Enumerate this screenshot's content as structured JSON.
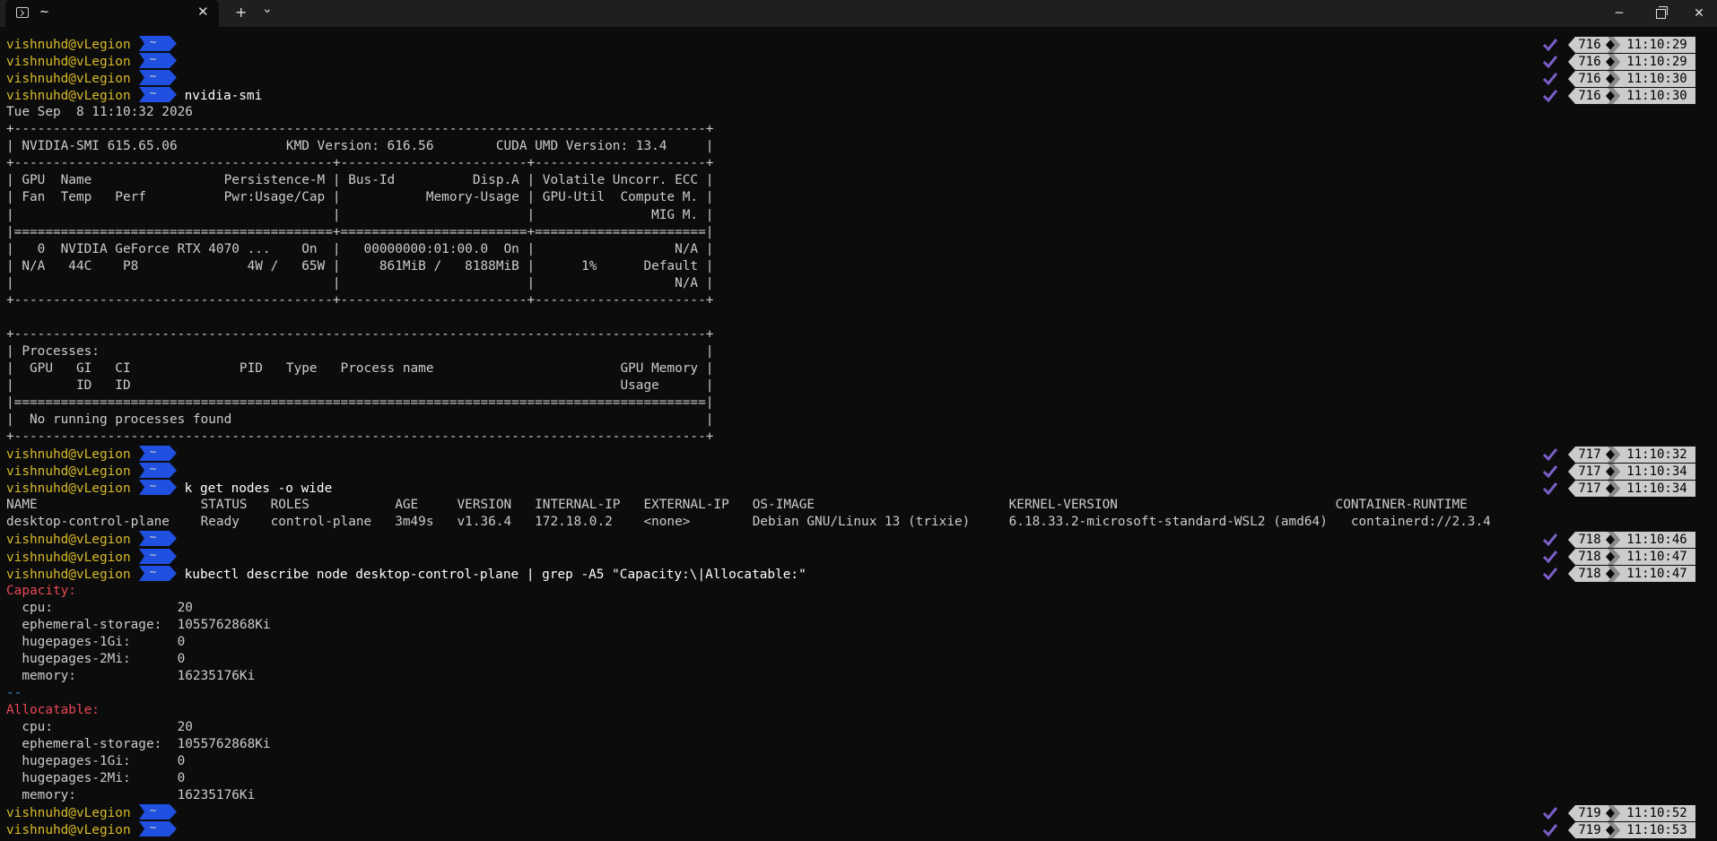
{
  "window": {
    "tab_title": "~",
    "tab_icon": "terminal-icon",
    "new_tab_label": "+",
    "dropdown_label": "⌄",
    "close_tab_label": "✕",
    "minimize_label": "─",
    "close_label": "✕"
  },
  "prompt": {
    "user": "vishnuhd@vLegion",
    "dir": "~",
    "colors": {
      "user": "#d7ba2a",
      "arrow": "#1f50e0",
      "status_bg": "#cccccc",
      "check": "#7a5fc8"
    }
  },
  "lines": [
    {
      "type": "prompt",
      "cmd": "",
      "num": "716",
      "time": "11:10:29"
    },
    {
      "type": "prompt",
      "cmd": "",
      "num": "716",
      "time": "11:10:29"
    },
    {
      "type": "prompt",
      "cmd": "",
      "num": "716",
      "time": "11:10:30"
    },
    {
      "type": "prompt",
      "cmd": "nvidia-smi",
      "num": "716",
      "time": "11:10:30"
    },
    {
      "type": "text",
      "text": "Tue Sep  8 11:10:32 2026"
    },
    {
      "type": "text",
      "text": "+-----------------------------------------------------------------------------------------+"
    },
    {
      "type": "text",
      "text": "| NVIDIA-SMI 615.65.06              KMD Version: 616.56        CUDA UMD Version: 13.4     |"
    },
    {
      "type": "text",
      "text": "+-----------------------------------------+------------------------+----------------------+"
    },
    {
      "type": "text",
      "text": "| GPU  Name                 Persistence-M | Bus-Id          Disp.A | Volatile Uncorr. ECC |"
    },
    {
      "type": "text",
      "text": "| Fan  Temp   Perf          Pwr:Usage/Cap |           Memory-Usage | GPU-Util  Compute M. |"
    },
    {
      "type": "text",
      "text": "|                                         |                        |               MIG M. |"
    },
    {
      "type": "text",
      "text": "|=========================================+========================+======================|"
    },
    {
      "type": "text",
      "text": "|   0  NVIDIA GeForce RTX 4070 ...    On  |   00000000:01:00.0  On |                  N/A |"
    },
    {
      "type": "text",
      "text": "| N/A   44C    P8              4W /   65W |     861MiB /   8188MiB |      1%      Default |"
    },
    {
      "type": "text",
      "text": "|                                         |                        |                  N/A |"
    },
    {
      "type": "text",
      "text": "+-----------------------------------------+------------------------+----------------------+"
    },
    {
      "type": "text",
      "text": ""
    },
    {
      "type": "text",
      "text": "+-----------------------------------------------------------------------------------------+"
    },
    {
      "type": "text",
      "text": "| Processes:                                                                              |"
    },
    {
      "type": "text",
      "text": "|  GPU   GI   CI              PID   Type   Process name                        GPU Memory |"
    },
    {
      "type": "text",
      "text": "|        ID   ID                                                               Usage      |"
    },
    {
      "type": "text",
      "text": "|=========================================================================================|"
    },
    {
      "type": "text",
      "text": "|  No running processes found                                                             |"
    },
    {
      "type": "text",
      "text": "+-----------------------------------------------------------------------------------------+"
    },
    {
      "type": "prompt",
      "cmd": "",
      "num": "717",
      "time": "11:10:32"
    },
    {
      "type": "prompt",
      "cmd": "",
      "num": "717",
      "time": "11:10:34"
    },
    {
      "type": "prompt",
      "cmd": "k get nodes -o wide",
      "num": "717",
      "time": "11:10:34"
    },
    {
      "type": "text",
      "text": "NAME                     STATUS   ROLES           AGE     VERSION   INTERNAL-IP   EXTERNAL-IP   OS-IMAGE                         KERNEL-VERSION                            CONTAINER-RUNTIME"
    },
    {
      "type": "text",
      "text": "desktop-control-plane    Ready    control-plane   3m49s   v1.36.4   172.18.0.2    <none>        Debian GNU/Linux 13 (trixie)     6.18.33.2-microsoft-standard-WSL2 (amd64)   containerd://2.3.4"
    },
    {
      "type": "prompt",
      "cmd": "",
      "num": "718",
      "time": "11:10:46"
    },
    {
      "type": "prompt",
      "cmd": "",
      "num": "718",
      "time": "11:10:47"
    },
    {
      "type": "prompt",
      "cmd": "kubectl describe node desktop-control-plane | grep -A5 \"Capacity:\\|Allocatable:\"",
      "num": "718",
      "time": "11:10:47"
    },
    {
      "type": "red",
      "text": "Capacity:"
    },
    {
      "type": "text",
      "text": "  cpu:                20"
    },
    {
      "type": "text",
      "text": "  ephemeral-storage:  1055762868Ki"
    },
    {
      "type": "text",
      "text": "  hugepages-1Gi:      0"
    },
    {
      "type": "text",
      "text": "  hugepages-2Mi:      0"
    },
    {
      "type": "text",
      "text": "  memory:             16235176Ki"
    },
    {
      "type": "sep",
      "text": "--"
    },
    {
      "type": "red",
      "text": "Allocatable:"
    },
    {
      "type": "text",
      "text": "  cpu:                20"
    },
    {
      "type": "text",
      "text": "  ephemeral-storage:  1055762868Ki"
    },
    {
      "type": "text",
      "text": "  hugepages-1Gi:      0"
    },
    {
      "type": "text",
      "text": "  hugepages-2Mi:      0"
    },
    {
      "type": "text",
      "text": "  memory:             16235176Ki"
    },
    {
      "type": "prompt",
      "cmd": "",
      "num": "719",
      "time": "11:10:52"
    },
    {
      "type": "prompt",
      "cmd": "",
      "num": "719",
      "time": "11:10:53"
    }
  ]
}
